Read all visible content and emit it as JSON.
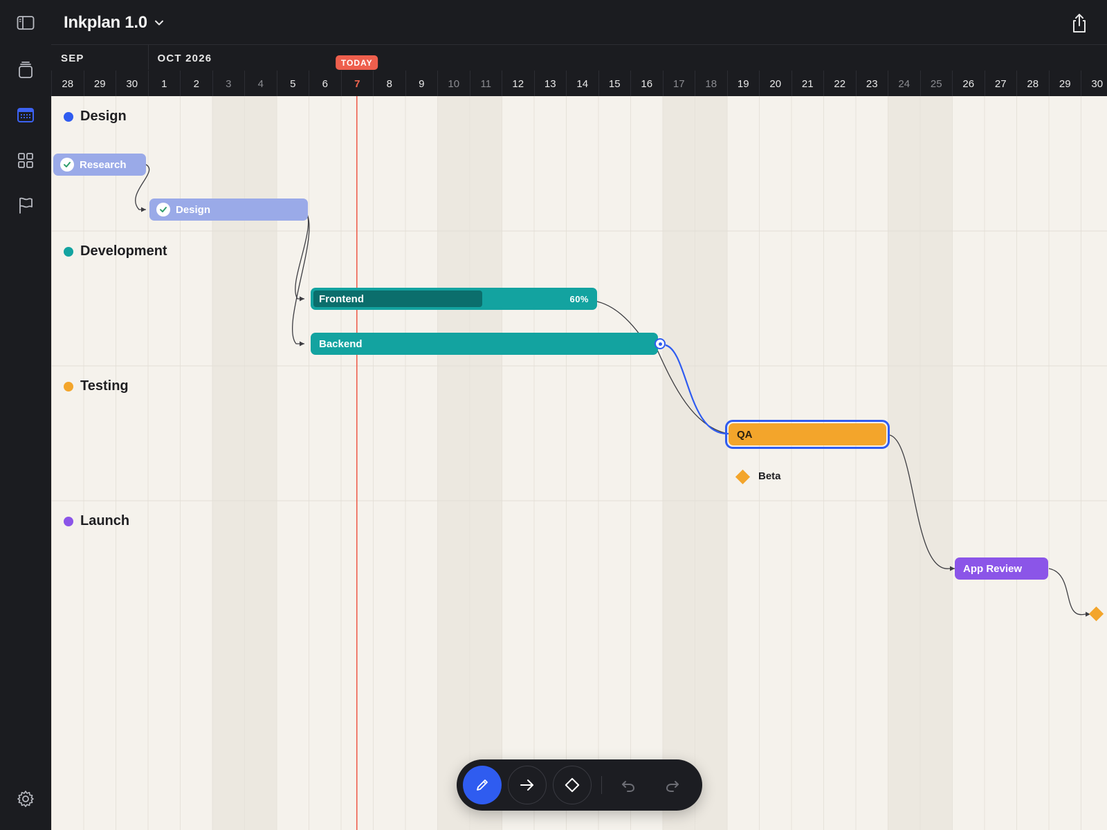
{
  "app": {
    "title": "Inkplan 1.0"
  },
  "colors": {
    "accent": "#2f5cf0",
    "today": "#ee5f4d",
    "design": "#2f5cf0",
    "development": "#13a3a0",
    "testing": "#f3a52b",
    "launch": "#8b55e8",
    "done_bar": "#9aaae8"
  },
  "rail": {
    "items": [
      {
        "name": "sidebar-toggle",
        "icon": "sidebar-icon"
      },
      {
        "name": "projects",
        "icon": "stack-icon"
      },
      {
        "name": "calendar",
        "icon": "calendar-icon",
        "active": true
      },
      {
        "name": "boards",
        "icon": "grid-icon"
      },
      {
        "name": "milestones",
        "icon": "flag-icon"
      },
      {
        "name": "settings",
        "icon": "gear-icon"
      }
    ]
  },
  "timeline": {
    "months": [
      {
        "label": "SEP",
        "start_index": 0
      },
      {
        "label": "OCT 2026",
        "start_index": 3
      }
    ],
    "today_label": "TODAY",
    "today_index": 9,
    "days": [
      "28",
      "29",
      "30",
      "1",
      "2",
      "3",
      "4",
      "5",
      "6",
      "7",
      "8",
      "9",
      "10",
      "11",
      "12",
      "13",
      "14",
      "15",
      "16",
      "17",
      "18",
      "19",
      "20",
      "21",
      "22",
      "23",
      "24",
      "25",
      "26",
      "27",
      "28",
      "29",
      "30"
    ],
    "weekend_indices": [
      5,
      6,
      12,
      13,
      19,
      20,
      26,
      27
    ]
  },
  "groups": [
    {
      "label": "Design",
      "color": "#2f5cf0"
    },
    {
      "label": "Development",
      "color": "#13a3a0"
    },
    {
      "label": "Testing",
      "color": "#f3a52b"
    },
    {
      "label": "Launch",
      "color": "#8b55e8"
    }
  ],
  "tasks": [
    {
      "id": "research",
      "label": "Research",
      "start": "Sep 28",
      "end": "Sep 30",
      "done": true
    },
    {
      "id": "design",
      "label": "Design",
      "start": "Oct 1",
      "end": "Oct 5",
      "done": true
    },
    {
      "id": "frontend",
      "label": "Frontend",
      "start": "Oct 6",
      "end": "Oct 14",
      "progress": 0.6,
      "progress_label": "60%"
    },
    {
      "id": "backend",
      "label": "Backend",
      "start": "Oct 6",
      "end": "Oct 16"
    },
    {
      "id": "qa",
      "label": "QA",
      "start": "Oct 19",
      "end": "Oct 23",
      "selected": true
    },
    {
      "id": "app_review",
      "label": "App Review",
      "start": "Oct 26",
      "end": "Oct 28"
    }
  ],
  "milestones": [
    {
      "id": "beta",
      "label": "Beta",
      "date": "Oct 19"
    },
    {
      "id": "release",
      "label": "",
      "date": "Oct 30"
    }
  ],
  "toolbar": {
    "tools": [
      {
        "name": "draw",
        "icon": "pencil-icon",
        "active": true
      },
      {
        "name": "link",
        "icon": "arrow-right-icon"
      },
      {
        "name": "milestone",
        "icon": "diamond-icon"
      },
      {
        "name": "undo",
        "icon": "undo-icon"
      },
      {
        "name": "redo",
        "icon": "redo-icon"
      }
    ]
  }
}
